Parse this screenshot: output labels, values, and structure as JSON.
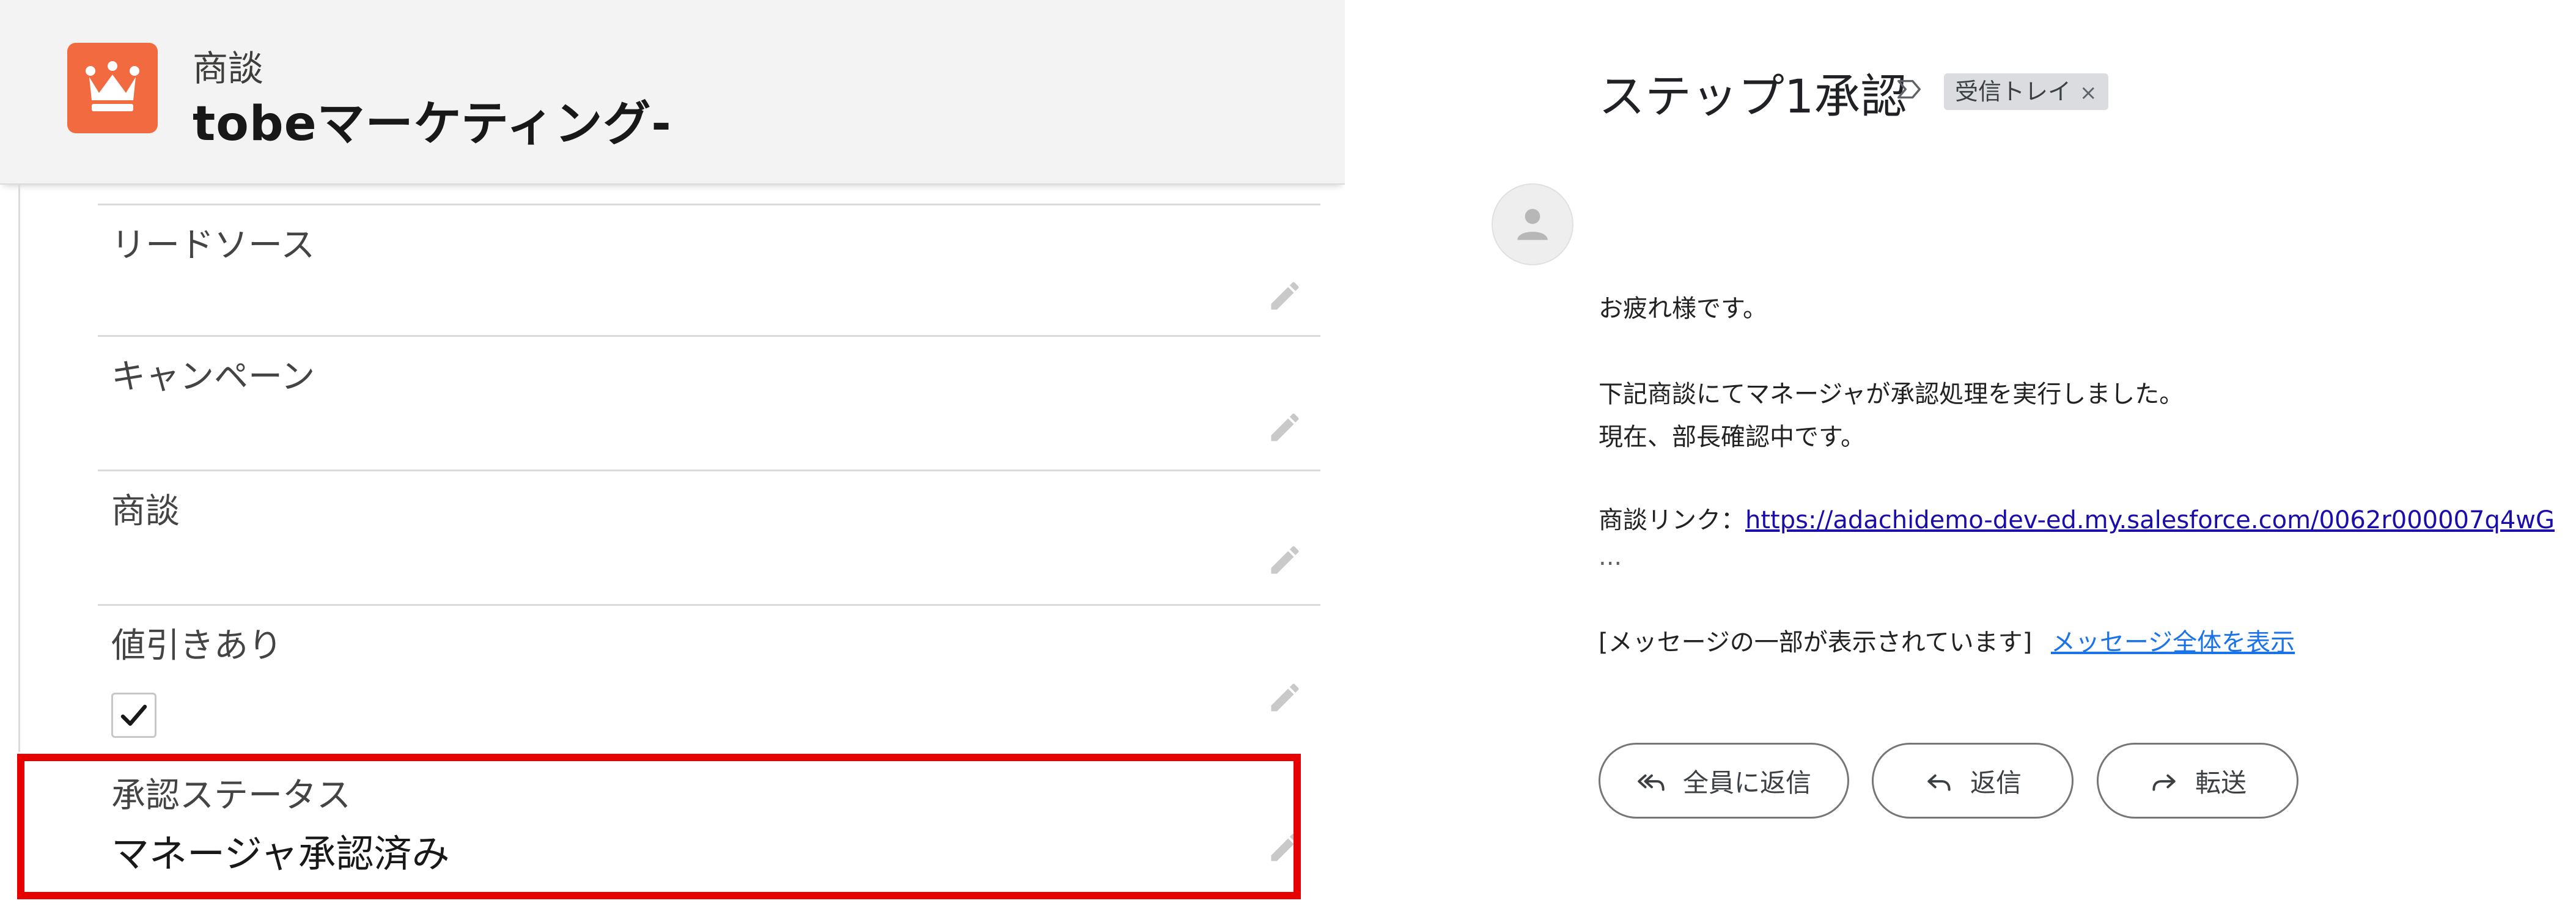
{
  "record": {
    "object_label": "商談",
    "title": "tobeマーケティング-",
    "icon": "crown-icon",
    "brand_color": "#f26a3f"
  },
  "fields": [
    {
      "label": "リードソース",
      "value": ""
    },
    {
      "label": "キャンペーン",
      "value": ""
    },
    {
      "label": "商談",
      "value": ""
    },
    {
      "label": "値引きあり",
      "checked": true
    },
    {
      "label": "承認ステータス",
      "value": "マネージャ承認済み"
    }
  ],
  "highlight_color": "#e60000",
  "email": {
    "subject": "ステップ1承認",
    "label_chip": "受信トレイ",
    "label_chip_close": "×",
    "greeting": "お疲れ様です。",
    "line1": "下記商談にてマネージャが承認処理を実行しました。",
    "line2": "現在、部長確認中です。",
    "link_prefix": "商談リンク：",
    "link_url": "https://adachidemo-dev-ed.my.salesforce.com/0062r000007q4wG",
    "ellipsis": "...",
    "clipped_notice": "[メッセージの一部が表示されています]",
    "view_full": "メッセージ全体を表示"
  },
  "actions": {
    "reply_all": "全員に返信",
    "reply": "返信",
    "forward": "転送"
  }
}
